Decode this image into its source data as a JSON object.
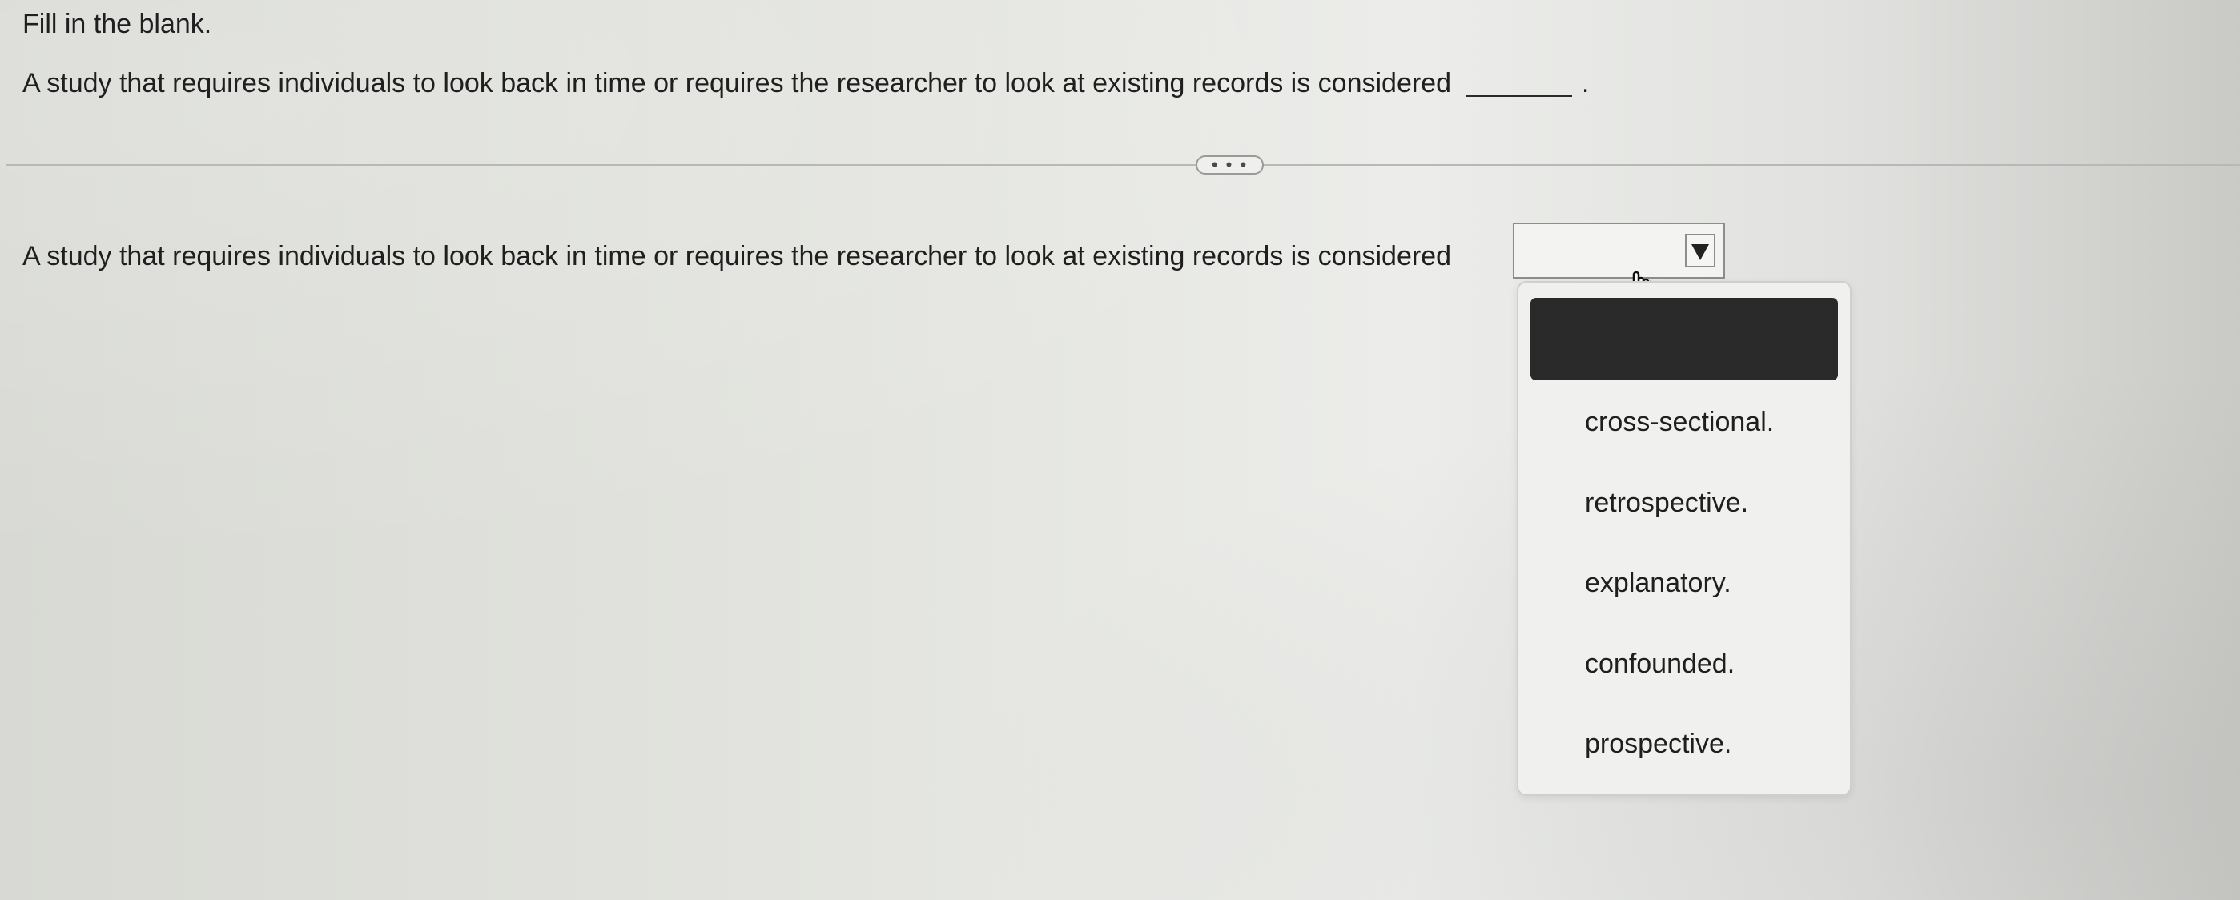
{
  "instructions": "Fill in the blank.",
  "question": {
    "text": "A study that requires individuals to look back in time or requires the researcher to look at existing records is considered",
    "period": "."
  },
  "more_button": {
    "label": "• • •"
  },
  "answer": {
    "text": "A study that requires individuals to look back in time or requires the researcher to look at existing records is considered",
    "selected_value": ""
  },
  "dropdown": {
    "options": [
      "cross-sectional.",
      "retrospective.",
      "explanatory.",
      "confounded.",
      "prospective."
    ]
  },
  "icons": {
    "dropdown": "dropdown-arrow-icon",
    "cursor": "hand-pointer-icon"
  }
}
